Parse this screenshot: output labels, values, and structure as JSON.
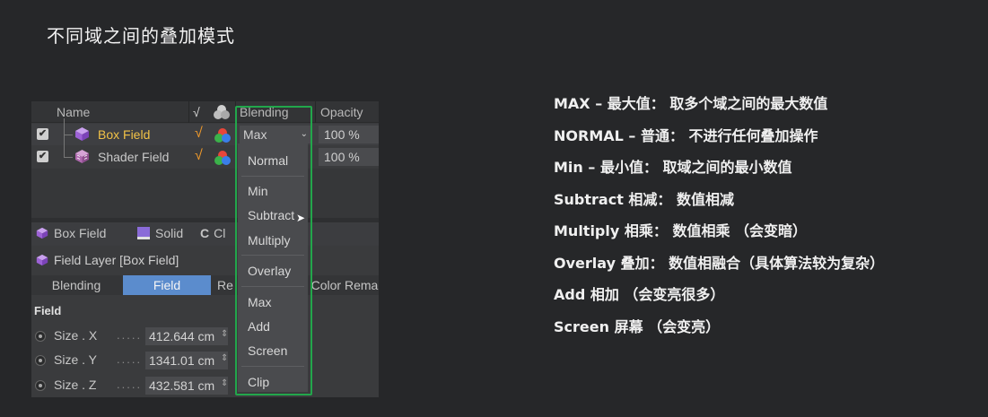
{
  "slide": {
    "title": "不同域之间的叠加模式"
  },
  "layers": {
    "headers": {
      "name": "Name",
      "blending": "Blending",
      "opacity": "Opacity"
    },
    "rows": [
      {
        "name": "Box Field",
        "blending": "Max",
        "opacity": "100 %",
        "checked": true
      },
      {
        "name": "Shader Field",
        "opacity": "100 %",
        "checked": true
      }
    ]
  },
  "attributes": {
    "toolbar": {
      "box_field": "Box Field",
      "solid": "Solid",
      "other": "Cl"
    },
    "title": "Field Layer [Box Field]",
    "tabs": [
      "Blending",
      "Field",
      "Re",
      "Color Rema"
    ],
    "active_tab": "Field",
    "section": "Field",
    "fields": [
      {
        "label": "Size . X",
        "dots": ".....",
        "value": "412.644 cm"
      },
      {
        "label": "Size . Y",
        "dots": ".....",
        "value": "1341.01 cm"
      },
      {
        "label": "Size . Z",
        "dots": ".....",
        "value": "432.581 cm"
      }
    ]
  },
  "blend_menu": {
    "items": [
      "Normal",
      "Min",
      "Subtract",
      "Multiply",
      "Overlay",
      "Max",
      "Add",
      "Screen",
      "Clip"
    ]
  },
  "notes": [
    "MAX – 最大值： 取多个域之间的最大数值",
    "NORMAL – 普通： 不进行任何叠加操作",
    "Min – 最小值： 取域之间的最小数值",
    "Subtract 相减： 数值相减",
    "Multiply 相乘： 数值相乘 （会变暗）",
    "Overlay 叠加： 数值相融合（具体算法较为复杂）",
    "Add 相加 （会变亮很多）",
    "Screen 屏幕 （会变亮）"
  ],
  "colors": {
    "highlight": "#22a64b",
    "selected_name": "#f1c247",
    "active_tab": "#5b8ccd"
  }
}
